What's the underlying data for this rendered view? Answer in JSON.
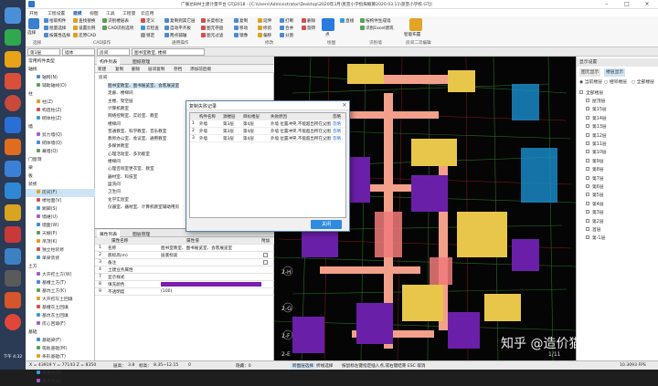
{
  "window": {
    "title": "广联达BIM土建计量平台 GTJ2018 - [C:\\Users\\Administrator\\Desktop\\2020年3月\\莫芸小学指挥概算2020.03.11\\莫芸小学校.GTJ]"
  },
  "menu": [
    "开始",
    "工程设置",
    "建模",
    "视图",
    "工具",
    "工程量",
    "云应用"
  ],
  "ribbon": {
    "select_label": "选择",
    "col1": [
      "拾取构件",
      "批量选择",
      "按属性选择"
    ],
    "col2": [
      "查找替换",
      "设置比例",
      "还原CAD"
    ],
    "col3": [
      "识别楼层表",
      "CAD识别选项"
    ],
    "col4": [
      "定义",
      "云检查",
      "锁定"
    ],
    "col5": [
      "复制到其它层",
      "自动平齐板",
      "两点辅轴"
    ],
    "col6": [
      "长度标注",
      "图元存盘",
      "图元过滤"
    ],
    "col7": [
      "复制",
      "移动",
      "镜像"
    ],
    "col8": [
      "延伸",
      "修剪",
      "偏移"
    ],
    "col9": [
      "打断",
      "合并",
      "分割"
    ],
    "col10": [
      "删除",
      "旋转"
    ],
    "col11": [
      "点",
      "直线"
    ],
    "col12": [
      "按构件生成墙",
      "识别Excel建筑",
      "智能布置"
    ],
    "smart_label": "智能布置",
    "groups": [
      "选择",
      "CAD操作",
      "通用操作",
      "修改",
      "绘图",
      "识别墙",
      "房间二次编辑"
    ]
  },
  "toolbar": {
    "floor": "第3层",
    "category": "墙体",
    "type": "房间",
    "name": "图书室教室, 楼梯"
  },
  "leftnav": {
    "groups": [
      {
        "label": "常用构件类型",
        "items": []
      },
      {
        "label": "轴线",
        "items": [
          "轴网(N)",
          "辅助轴线(O)"
        ]
      },
      {
        "label": "柱",
        "items": [
          "柱(Z)",
          "构造柱(Z)",
          "砌体柱(Z)"
        ]
      },
      {
        "label": "墙",
        "items": [
          "剪力墙(Q)",
          "砌体墙(Q)",
          "幕墙(Q)"
        ]
      },
      {
        "label": "门窗洞",
        "items": []
      },
      {
        "label": "梁",
        "items": []
      },
      {
        "label": "板",
        "items": []
      },
      {
        "label": "装修",
        "items": [
          "房间(F)",
          "楼地面(V)",
          "踢脚(S)",
          "墙裙(U)",
          "墙面(W)",
          "天棚(P)",
          "吊顶(K)",
          "独立柱装修",
          "单梁装修"
        ]
      },
      {
        "label": "土方",
        "items": [
          "大开挖土方(W)",
          "基槽土方(T)",
          "基坑土方(K)",
          "大开挖灰土回填",
          "基槽灰土回填",
          "基坑灰土回填",
          "房心回填(F)"
        ]
      },
      {
        "label": "基础",
        "items": [
          "基础梁(F)",
          "筏板基础(M)",
          "条形基础(T)",
          "独立基础(D)",
          "桩承台(V)",
          "集水坑(K)"
        ]
      }
    ]
  },
  "components": {
    "tabs": [
      "构件列表",
      "图纸管理"
    ],
    "toolbar": [
      "新建",
      "复制",
      "删除",
      "层间复制",
      "存档",
      "添加前后缀"
    ],
    "root": "房间",
    "items": [
      "图书室教室、图书展览室、会客展览室",
      "走廊、楼梯间",
      "主楼、架空层",
      "计算机教室",
      "网络控制室、实验室、教室",
      "楼梯间",
      "普通教室、科学教室、音乐教室",
      "教师办公室、会议室、通用教室",
      "多媒体教室",
      "心理活动室、多功能室",
      "楼梯间",
      "心理咨询室更衣室、教室",
      "器材室、科技室",
      "盥洗间",
      "卫生间",
      "化学实验室",
      "仪器室、器材室、计算机教室辅助用房"
    ]
  },
  "props": {
    "tabs": [
      "属性列表",
      "图层管理"
    ],
    "header": [
      "属性名称",
      "属性值",
      "附加"
    ],
    "rows": [
      {
        "n": "1",
        "name": "名称",
        "value": "图书室教室、图书展览室、会客展览室",
        "check": false
      },
      {
        "n": "2",
        "name": "底标高(m)",
        "value": "层底标高",
        "check": true
      },
      {
        "n": "3",
        "name": "备注",
        "value": "",
        "check": true
      },
      {
        "n": "4",
        "name": "土建业务属性",
        "value": "",
        "check": false
      },
      {
        "n": "7",
        "name": "显示样式",
        "value": "",
        "check": false
      },
      {
        "n": "8",
        "name": "填充颜色",
        "value": "",
        "check": false
      },
      {
        "n": "9",
        "name": "不透明度",
        "value": "(100)",
        "check": false
      }
    ],
    "fill_color": "#7a1fb0"
  },
  "dialog": {
    "title": "复制失败记录",
    "columns": [
      "构件名称",
      "源楼层",
      "目标楼层",
      "失败原因",
      "忽略"
    ],
    "rows": [
      {
        "n": "1",
        "name": "外墙",
        "src": "第3层",
        "dst": "第4层",
        "reason": "外墙 位置冲突,不能超出所在父图元的范围",
        "act": "忽略"
      },
      {
        "n": "2",
        "name": "外墙",
        "src": "第3层",
        "dst": "第4层",
        "reason": "外墙 位置冲突,不能超出所在父图元的范围",
        "act": "忽略"
      },
      {
        "n": "3",
        "name": "外墙",
        "src": "第3层",
        "dst": "第4层",
        "reason": "外墙 位置冲突,不能超出所在父图元的范围",
        "act": "忽略"
      }
    ],
    "close_label": "关闭"
  },
  "rightpanel": {
    "title": "显示设置",
    "tabs": [
      "图元显示",
      "楼层显示"
    ],
    "radios": [
      "当前楼层",
      "相邻楼层",
      "全部楼层"
    ],
    "root": "全部楼层",
    "floors": [
      "屋顶层",
      "第15层",
      "第14层",
      "第13层",
      "第12层",
      "第11层",
      "第10层",
      "第9层",
      "第8层",
      "第7层",
      "第6层",
      "第5层",
      "第4层",
      "第3层",
      "第2层",
      "首层",
      "第-1层"
    ]
  },
  "canvas": {
    "labels": [
      "2-H",
      "2-G",
      "2-F",
      "2-E",
      "1/11"
    ]
  },
  "status": {
    "coords": "X = 43919 Y = 77143 Z = 8350",
    "height_label": "层高：",
    "height": "3.8",
    "elev_label": "标高：",
    "elev": "8.35~12.15",
    "scale": "0",
    "hidden": "隐藏：0",
    "grid": "跨图层选择",
    "mode": "折线选择",
    "tip": "按鼠标左键指定插入点,或右键结束 ESC 取消",
    "fps": "10.3093 FPS"
  },
  "desktop": {
    "time": "下午 4:32"
  },
  "watermark": "知乎 @造价猫大洋"
}
